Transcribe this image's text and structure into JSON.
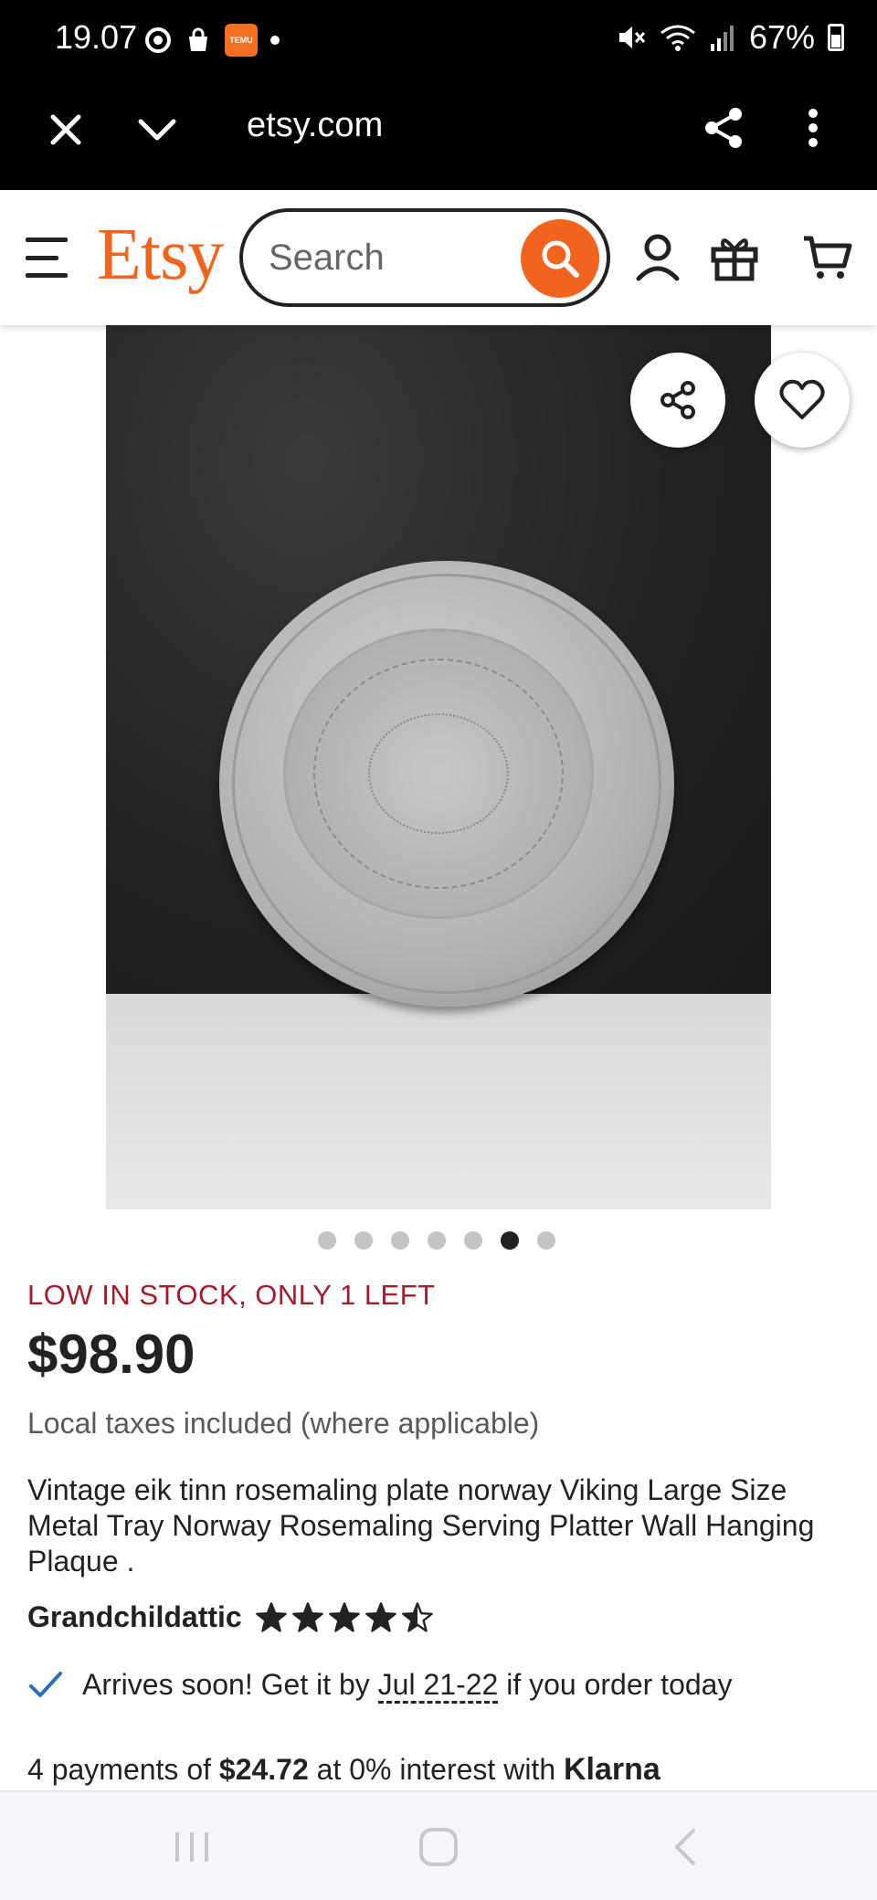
{
  "status_bar": {
    "time": "19.07",
    "battery": "67%",
    "temu_label": "TEMU"
  },
  "browser": {
    "url": "etsy.com"
  },
  "header": {
    "logo": "Etsy",
    "search_placeholder": "Search",
    "accent_color": "#f1641e"
  },
  "carousel": {
    "total": 7,
    "active_index": 5
  },
  "product": {
    "stock_notice": "LOW IN STOCK, ONLY 1 LEFT",
    "price": "$98.90",
    "taxes_note": "Local taxes included (where applicable)",
    "title": "Vintage eik tinn rosemaling plate norway Viking Large Size Metal Tray Norway Rosemaling Serving Platter Wall Hanging Plaque .",
    "shop_name": "Grandchildattic",
    "rating": 4.5,
    "arrival": {
      "prefix": "Arrives soon! Get it by ",
      "date": "Jul 21-22",
      "suffix": " if you order today"
    },
    "payments": {
      "prefix": "4 payments of ",
      "amount": "$24.72",
      "middle": " at 0% interest with ",
      "provider": "Klarna"
    }
  },
  "icons": [
    "close-icon",
    "chevron-down-icon",
    "share-icon",
    "more-vert-icon",
    "menu-icon",
    "search-icon",
    "user-icon",
    "gift-icon",
    "cart-icon",
    "heart-icon",
    "check-icon",
    "star-icon",
    "recent-apps-icon",
    "home-icon",
    "back-icon"
  ]
}
